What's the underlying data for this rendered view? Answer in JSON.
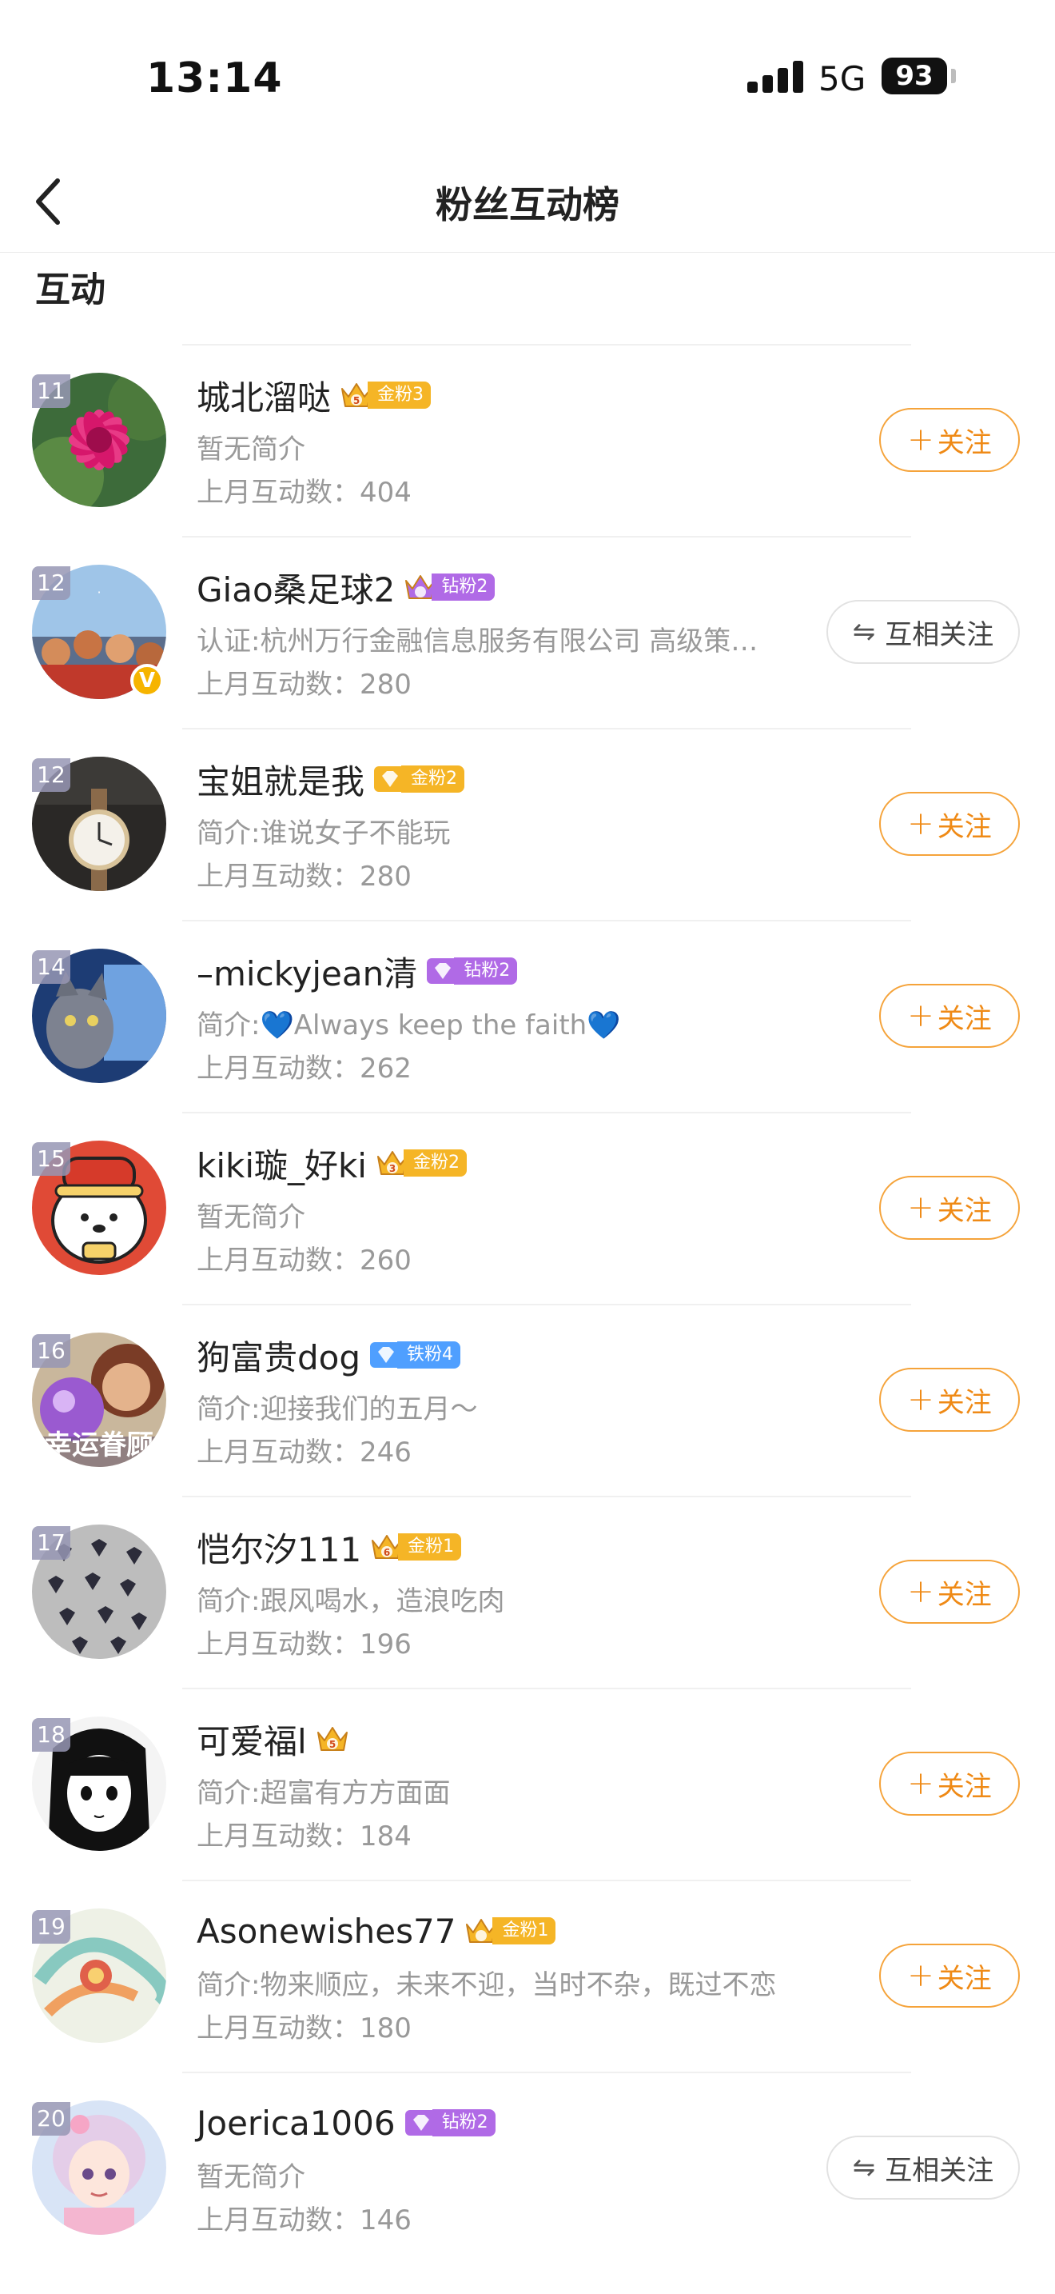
{
  "status_bar": {
    "time": "13:14",
    "network": "5G",
    "battery": "93"
  },
  "nav": {
    "title": "粉丝互动榜"
  },
  "section": {
    "title": "互动"
  },
  "colors": {
    "accent_orange": "#ef8a16",
    "follow_border": "#f5a33a",
    "gold": "#f5b526",
    "diamond": "#b06ae6",
    "iron": "#4f9fff"
  },
  "follow_label": "关注",
  "follow_plus": "+",
  "mutual_label": "互相关注",
  "mutual_icon": "⇋",
  "fans": [
    {
      "rank": "11",
      "name": "城北溜哒",
      "badge_icon": "crown-icon",
      "badge_num": "5",
      "badge_text": "金粉3",
      "badge_color": "gold",
      "intro": "暂无简介",
      "count": "上月互动数：404",
      "button": "follow",
      "avatar": "flower"
    },
    {
      "rank": "12",
      "name": "Giao桑足球2",
      "badge_icon": "crown-icon",
      "badge_num": "",
      "badge_text": "钻粉2",
      "badge_color": "diamond",
      "intro": "认证:杭州万行金融信息服务有限公司 高级策…",
      "count": "上月互动数：280",
      "button": "mutual",
      "avatar": "crowd",
      "verified": "V"
    },
    {
      "rank": "12",
      "name": "宝姐就是我",
      "badge_icon": "gem-icon",
      "badge_num": "",
      "badge_text": "金粉2",
      "badge_color": "gold",
      "intro": "简介:谁说女子不能玩",
      "count": "上月互动数：280",
      "button": "follow",
      "avatar": "watch"
    },
    {
      "rank": "14",
      "name": "–mickyjean清",
      "badge_icon": "gem-icon",
      "badge_num": "",
      "badge_text": "钻粉2",
      "badge_color": "diamond",
      "intro": "简介:💙Always keep the faith💙",
      "count": "上月互动数：262",
      "button": "follow",
      "avatar": "cat"
    },
    {
      "rank": "15",
      "name": "kiki璇_好ki",
      "badge_icon": "crown-icon",
      "badge_num": "3",
      "badge_text": "金粉2",
      "badge_color": "gold",
      "intro": "暂无简介",
      "count": "上月互动数：260",
      "button": "follow",
      "avatar": "dog"
    },
    {
      "rank": "16",
      "name": "狗富贵dog",
      "badge_icon": "gem-icon",
      "badge_num": "",
      "badge_text": "铁粉4",
      "badge_color": "iron",
      "intro": "简介:迎接我们的五月～",
      "count": "上月互动数：246",
      "button": "follow",
      "avatar": "luck",
      "avatar_text": "幸运眷顾"
    },
    {
      "rank": "17",
      "name": "恺尔汐111",
      "badge_icon": "crown-icon",
      "badge_num": "6",
      "badge_text": "金粉1",
      "badge_color": "gold",
      "intro": "简介:跟风喝水，造浪吃肉",
      "count": "上月互动数：196",
      "button": "follow",
      "avatar": "birds"
    },
    {
      "rank": "18",
      "name": "可爱福l",
      "badge_icon": "crown-icon",
      "badge_num": "5",
      "badge_text": "",
      "badge_color": "gold",
      "intro": "简介:超富有方方面面",
      "count": "上月互动数：184",
      "button": "follow",
      "avatar": "anime"
    },
    {
      "rank": "19",
      "name": "Asonewishes77",
      "badge_icon": "crown-icon",
      "badge_num": "",
      "badge_text": "金粉1",
      "badge_color": "gold",
      "intro": "简介:物来顺应，未来不迎，当时不杂，既过不恋",
      "count": "上月互动数：180",
      "button": "follow",
      "avatar": "swirl"
    },
    {
      "rank": "20",
      "name": "Joerica1006",
      "badge_icon": "gem-icon",
      "badge_num": "",
      "badge_text": "钻粉2",
      "badge_color": "diamond",
      "intro": "暂无简介",
      "count": "上月互动数：146",
      "button": "mutual",
      "avatar": "girl"
    }
  ]
}
